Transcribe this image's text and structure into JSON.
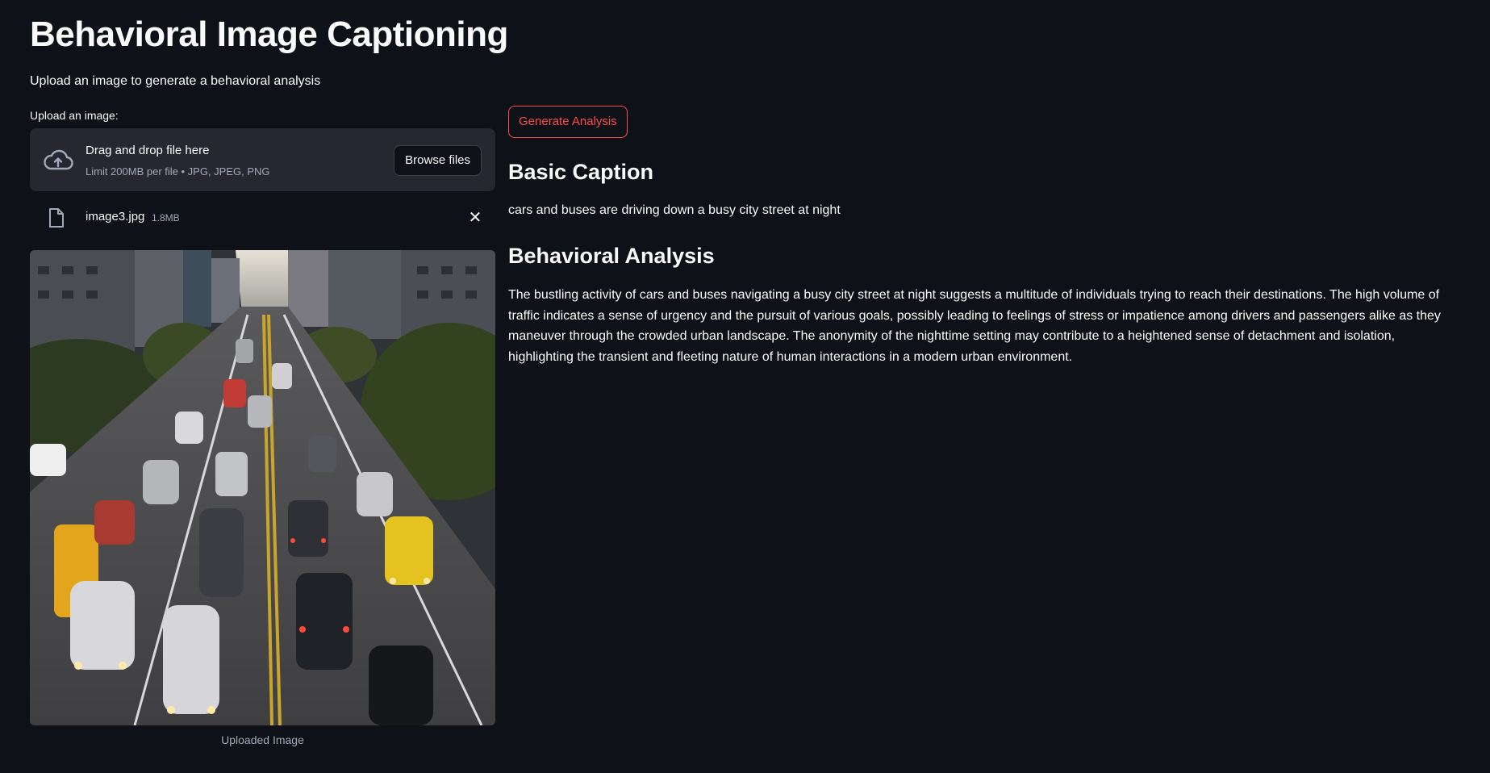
{
  "app": {
    "title": "Behavioral Image Captioning",
    "subtitle": "Upload an image to generate a behavioral analysis"
  },
  "uploader": {
    "label": "Upload an image:",
    "drop_title": "Drag and drop file here",
    "limit_text": "Limit 200MB per file • JPG, JPEG, PNG",
    "browse_label": "Browse files",
    "file_name": "image3.jpg",
    "file_size": "1.8MB",
    "icons": {
      "upload": "cloud-upload-icon",
      "file": "file-icon",
      "remove": "close-icon"
    }
  },
  "image": {
    "caption": "Uploaded Image"
  },
  "actions": {
    "generate_label": "Generate Analysis"
  },
  "basic_caption": {
    "heading": "Basic Caption",
    "text": "cars and buses are driving down a busy city street at night"
  },
  "behavioral_analysis": {
    "heading": "Behavioral Analysis",
    "text": "The bustling activity of cars and buses navigating a busy city street at night suggests a multitude of individuals trying to reach their destinations. The high volume of traffic indicates a sense of urgency and the pursuit of various goals, possibly leading to feelings of stress or impatience among drivers and passengers alike as they maneuver through the crowded urban landscape. The anonymity of the nighttime setting may contribute to a heightened sense of detachment and isolation, highlighting the transient and fleeting nature of human interactions in a modern urban environment."
  },
  "colors": {
    "background": "#0e1117",
    "panel": "#262730",
    "accent": "#ff4b4b",
    "text": "#fafafa",
    "muted": "#a3a8b8"
  }
}
